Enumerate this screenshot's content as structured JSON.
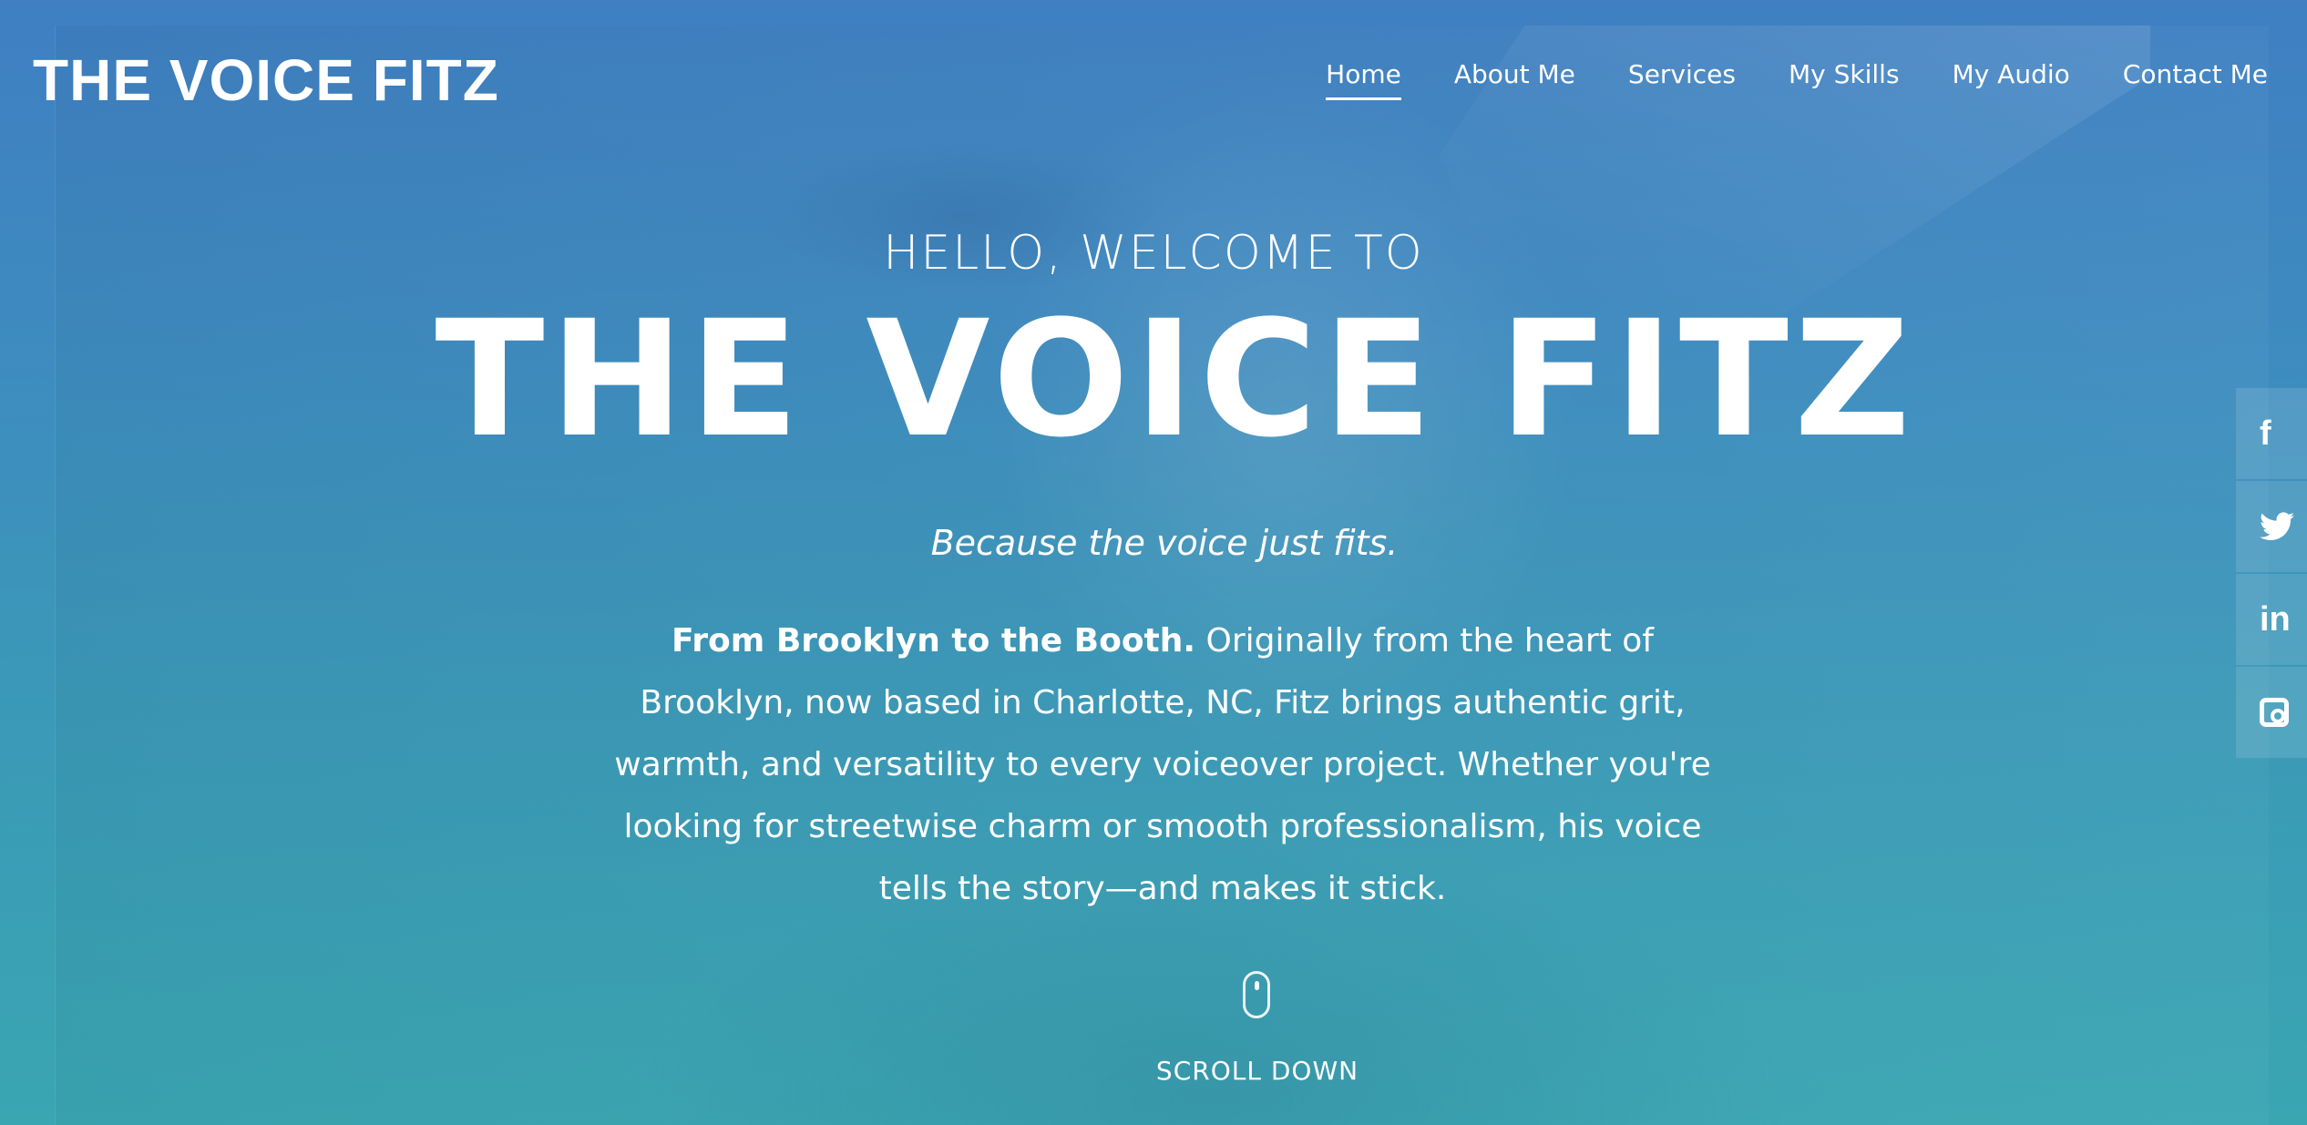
{
  "header": {
    "logo": "THE VOICE FITZ",
    "nav": [
      {
        "label": "Home",
        "active": true
      },
      {
        "label": "About Me",
        "active": false
      },
      {
        "label": "Services",
        "active": false
      },
      {
        "label": "My Skills",
        "active": false
      },
      {
        "label": "My Audio",
        "active": false
      },
      {
        "label": "Contact Me",
        "active": false
      }
    ]
  },
  "hero": {
    "welcome": "HELLO, WELCOME TO",
    "title": "THE VOICE FITZ",
    "tagline": "Because the voice just fits.",
    "intro_bold": "From Brooklyn to the Booth.",
    "intro_text": " Originally from the heart of Brooklyn, now based in Charlotte, NC, Fitz brings authentic grit, warmth, and versatility to every voiceover project. Whether you're looking for streetwise charm or smooth professionalism, his voice tells the story—and makes it stick.",
    "scroll_label": "SCROLL DOWN"
  },
  "social": [
    {
      "name": "facebook-icon",
      "glyph": "f"
    },
    {
      "name": "twitter-icon",
      "glyph": "🐦"
    },
    {
      "name": "linkedin-icon",
      "glyph": "in"
    },
    {
      "name": "instagram-icon",
      "glyph": ""
    }
  ],
  "colors": {
    "gradient_top": "#3f7fc2",
    "gradient_bottom": "#3aa6b2",
    "text": "#ffffff"
  }
}
